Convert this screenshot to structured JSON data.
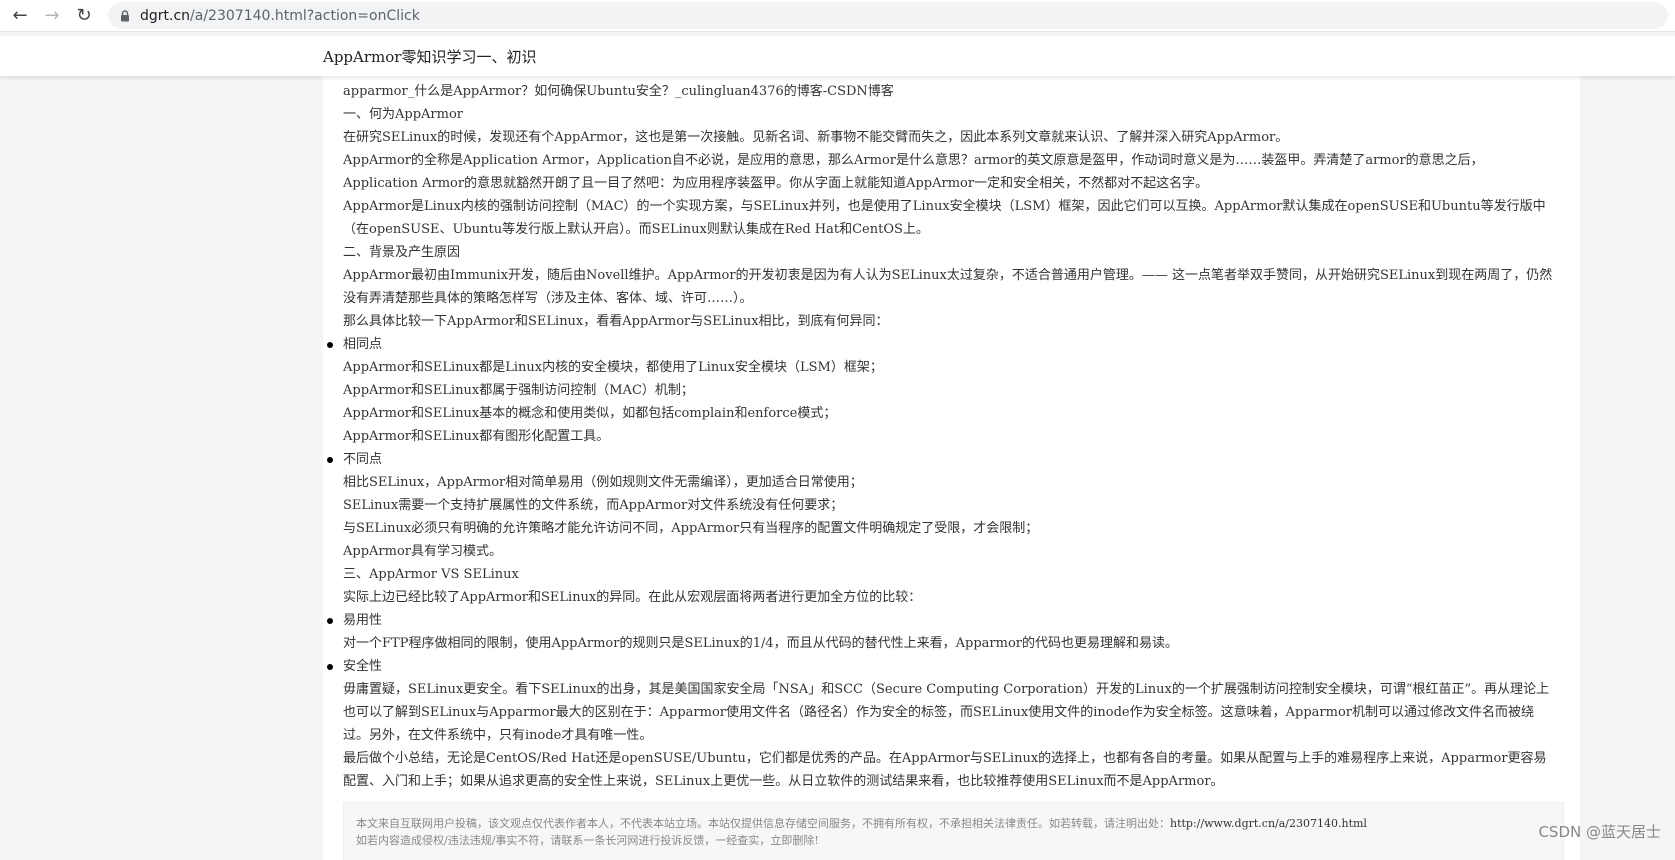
{
  "browser": {
    "url_domain": "dgrt.cn",
    "url_path": "/a/2307140.html?action=onClick"
  },
  "site": {
    "title": "AppArmor零知识学习一、初识"
  },
  "article": {
    "paragraphs_intro": [
      "apparmor_什么是AppArmor？如何确保Ubuntu安全？_culingluan4376的博客-CSDN博客",
      "一、何为AppArmor",
      "在研究SELinux的时候，发现还有个AppArmor，这也是第一次接触。见新名词、新事物不能交臂而失之，因此本系列文章就来认识、了解并深入研究AppArmor。",
      "AppArmor的全称是Application Armor，Application自不必说，是应用的意思，那么Armor是什么意思？armor的英文原意是盔甲，作动词时意义是为……装盔甲。弄清楚了armor的意思之后，Application Armor的意思就豁然开朗了且一目了然吧：为应用程序装盔甲。你从字面上就能知道AppArmor一定和安全相关，不然都对不起这名字。",
      "AppArmor是Linux内核的强制访问控制（MAC）的一个实现方案，与SELinux并列，也是使用了Linux安全模块（LSM）框架，因此它们可以互换。AppArmor默认集成在openSUSE和Ubuntu等发行版中（在openSUSE、Ubuntu等发行版上默认开启）。而SELinux则默认集成在Red Hat和CentOS上。",
      "二、背景及产生原因",
      "AppArmor最初由Immunix开发，随后由Novell维护。AppArmor的开发初衷是因为有人认为SELinux太过复杂，不适合普通用户管理。—— 这一点笔者举双手赞同，从开始研究SELinux到现在两周了，仍然没有弄清楚那些具体的策略怎样写（涉及主体、客体、域、许可……）。",
      "那么具体比较一下AppArmor和SELinux，看看AppArmor与SELinux相比，到底有何异同："
    ],
    "same_heading": "相同点",
    "same_points": [
      "AppArmor和SELinux都是Linux内核的安全模块，都使用了Linux安全模块（LSM）框架；",
      "AppArmor和SELinux都属于强制访问控制（MAC）机制；",
      "AppArmor和SELinux基本的概念和使用类似，如都包括complain和enforce模式；",
      "AppArmor和SELinux都有图形化配置工具。"
    ],
    "diff_heading": "不同点",
    "diff_points": [
      "相比SELinux，AppArmor相对简单易用（例如规则文件无需编译），更加适合日常使用；",
      "SELinux需要一个支持扩展属性的文件系统，而AppArmor对文件系统没有任何要求；",
      "与SELinux必须只有明确的允许策略才能允许访问不同，AppArmor只有当程序的配置文件明确规定了受限，才会限制；",
      "AppArmor具有学习模式。"
    ],
    "section3_heading": "三、AppArmor VS SELinux",
    "section3_intro": "实际上边已经比较了AppArmor和SELinux的异同。在此从宏观层面将两者进行更加全方位的比较：",
    "ease_heading": "易用性",
    "ease_text": "对一个FTP程序做相同的限制，使用AppArmor的规则只是SELinux的1/4，而且从代码的替代性上来看，Apparmor的代码也更易理解和易读。",
    "security_heading": "安全性",
    "security_text": "毋庸置疑，SELinux更安全。看下SELinux的出身，其是美国国家安全局「NSA」和SCC（Secure Computing Corporation）开发的Linux的一个扩展强制访问控制安全模块，可谓“根红苗正”。再从理论上也可以了解到SELinux与Apparmor最大的区别在于：Apparmor使用文件名（路径名）作为安全的标签，而SELinux使用文件的inode作为安全标签。这意味着，Apparmor机制可以通过修改文件名而被绕过。另外，在文件系统中，只有inode才具有唯一性。",
    "conclusion": "最后做个小总结，无论是CentOS/Red Hat还是openSUSE/Ubuntu，它们都是优秀的产品。在AppArmor与SELinux的选择上，也都有各自的考量。如果从配置与上手的难易程序上来说，Apparmor更容易配置、入门和上手；如果从追求更高的安全性上来说，SELinux上更优一些。从日立软件的测试结果来看，也比较推荐使用SELinux而不是AppArmor。"
  },
  "copyright": {
    "line1": "本文来自互联网用户投稿，该文观点仅代表作者本人，不代表本站立场。本站仅提供信息存储空间服务，不拥有所有权，不承担相关法律责任。如若转载，请注明出处：",
    "source_url": "http://www.dgrt.cn/a/2307140.html",
    "line2": "如若内容造成侵权/违法违规/事实不符，请联系一条长河网进行投诉反馈，一经查实，立即删除!"
  },
  "watermark": "CSDN @蓝天居士",
  "colors": {
    "page_bg": "#f4f5f5",
    "card_bg": "#ffffff",
    "text": "#333333"
  }
}
